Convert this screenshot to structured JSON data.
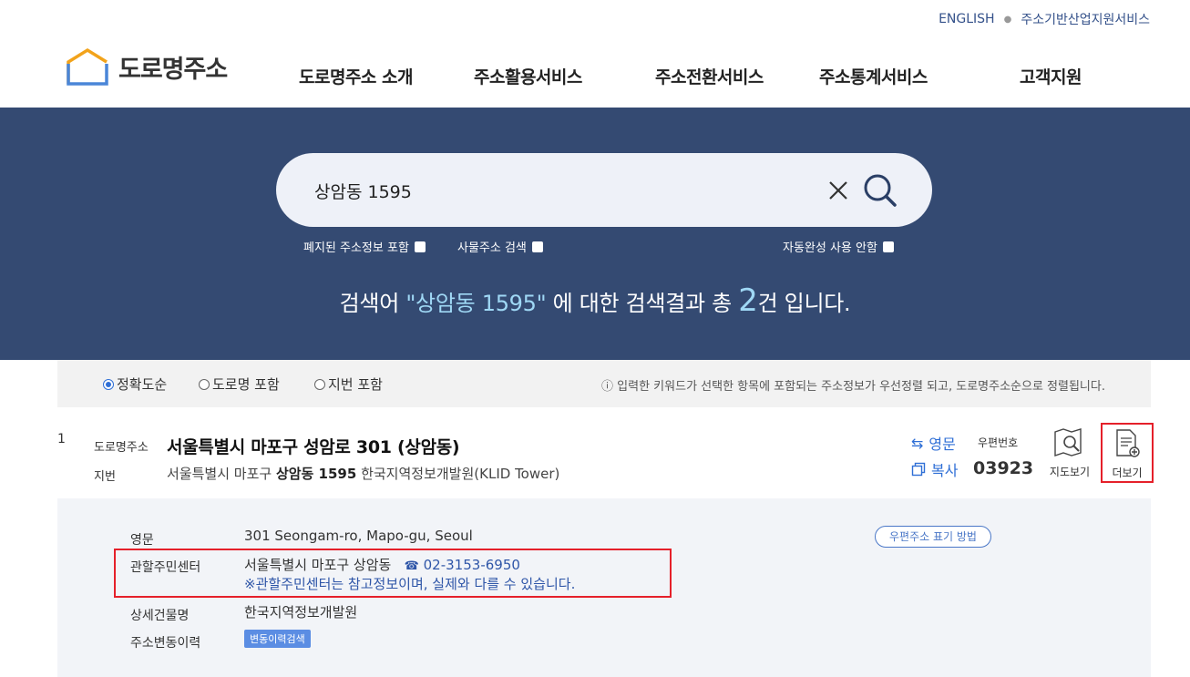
{
  "top_links": {
    "english": "ENGLISH",
    "industry": "주소기반산업지원서비스"
  },
  "logo": {
    "text": "도로명주소"
  },
  "nav": [
    {
      "label": "도로명주소 소개"
    },
    {
      "label": "주소활용서비스"
    },
    {
      "label": "주소전환서비스"
    },
    {
      "label": "주소통계서비스"
    },
    {
      "label": "고객지원"
    }
  ],
  "search": {
    "value": "상암동 1595",
    "options": {
      "include_abolished": "폐지된 주소정보 포함",
      "object_address": "사물주소 검색",
      "no_autocomplete": "자동완성 사용 안함"
    }
  },
  "result_message": {
    "prefix": "검색어 ",
    "keyword": "\"상암동 1595\"",
    "middle": " 에 대한 검색결과 총 ",
    "count": "2",
    "suffix": "건 입니다."
  },
  "sort": {
    "options": [
      {
        "label": "정확도순",
        "selected": true
      },
      {
        "label": "도로명 포함",
        "selected": false
      },
      {
        "label": "지번 포함",
        "selected": false
      }
    ],
    "note": "입력한 키워드가 선택한 항목에 포함되는 주소정보가 우선정렬 되고, 도로명주소순으로 정렬됩니다."
  },
  "result": {
    "number": "1",
    "road_label": "도로명주소",
    "road_address": "서울특별시 마포구 성암로 301 (상암동)",
    "jibun_label": "지번",
    "jibun": {
      "part1": "서울특별시 마포구 ",
      "bold1": "상암동 1595",
      "part2": " 한국지역정보개발원(KLID Tower)"
    },
    "english_btn": "영문",
    "copy_btn": "복사",
    "zip_label": "우편번호",
    "zip": "03923",
    "map_btn": "지도보기",
    "more_btn": "더보기"
  },
  "detail": {
    "english_label": "영문",
    "english_value": "301 Seongam-ro, Mapo-gu, Seoul",
    "postal_pill": "우편주소 표기 방법",
    "center_label": "관할주민센터",
    "center_value": "서울특별시 마포구 상암동",
    "center_phone": "02-3153-6950",
    "center_note": "※관할주민센터는 참고정보이며, 실제와 다를 수 있습니다.",
    "building_label": "상세건물명",
    "building_value": "한국지역정보개발원",
    "history_label": "주소변동이력",
    "history_btn": "변동이력검색"
  },
  "colors": {
    "hero": "#344a72",
    "accent": "#2f6fd6",
    "highlight": "#e5202a"
  }
}
